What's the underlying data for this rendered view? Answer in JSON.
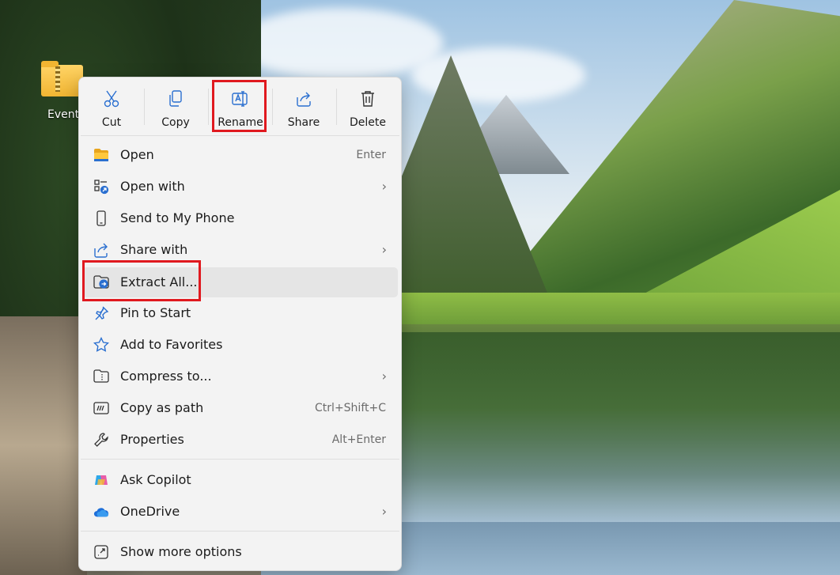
{
  "desktop": {
    "icon_label": "Event",
    "icon_name": "zip-folder-icon"
  },
  "context_menu": {
    "quick_actions": [
      {
        "label": "Cut",
        "icon": "scissors-icon"
      },
      {
        "label": "Copy",
        "icon": "copy-icon"
      },
      {
        "label": "Rename",
        "icon": "rename-icon"
      },
      {
        "label": "Share",
        "icon": "share-icon"
      },
      {
        "label": "Delete",
        "icon": "trash-icon"
      }
    ],
    "items": [
      {
        "label": "Open",
        "shortcut": "Enter",
        "icon": "folder-icon"
      },
      {
        "label": "Open with",
        "submenu": true,
        "icon": "open-with-icon"
      },
      {
        "label": "Send to My Phone",
        "icon": "phone-icon"
      },
      {
        "label": "Share with",
        "submenu": true,
        "icon": "share-with-icon"
      },
      {
        "label": "Extract All...",
        "icon": "extract-icon",
        "hovered": true
      },
      {
        "label": "Pin to Start",
        "icon": "pin-icon"
      },
      {
        "label": "Add to Favorites",
        "icon": "star-icon"
      },
      {
        "label": "Compress to...",
        "submenu": true,
        "icon": "compress-icon"
      },
      {
        "label": "Copy as path",
        "shortcut": "Ctrl+Shift+C",
        "icon": "copy-path-icon"
      },
      {
        "label": "Properties",
        "shortcut": "Alt+Enter",
        "icon": "wrench-icon"
      },
      {
        "label": "Ask Copilot",
        "icon": "copilot-icon"
      },
      {
        "label": "OneDrive",
        "submenu": true,
        "icon": "cloud-icon"
      },
      {
        "label": "Show more options",
        "icon": "more-options-icon"
      }
    ],
    "chevron": "›"
  },
  "colors": {
    "highlight": "#e0191f",
    "accent": "#1e6fd9",
    "menu_bg": "#f3f3f3"
  }
}
